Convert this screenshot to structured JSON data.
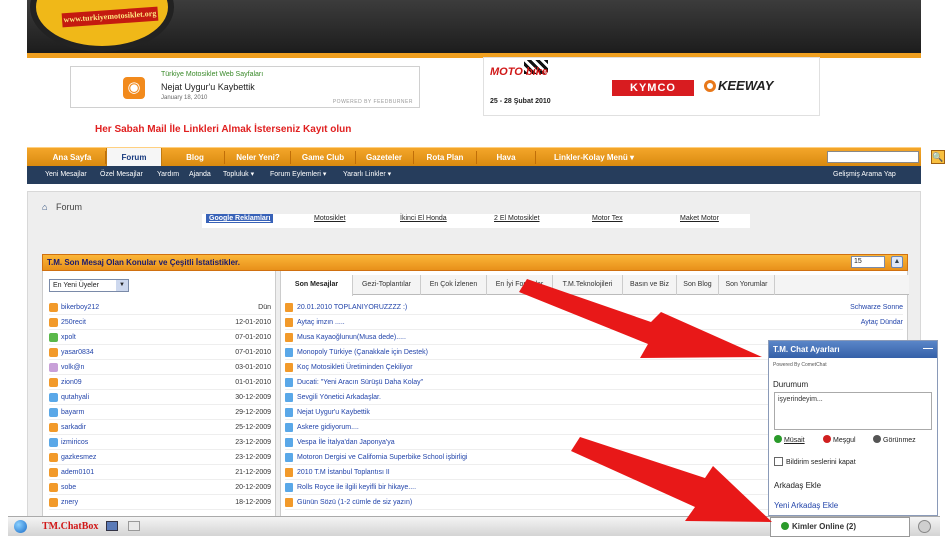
{
  "header": {
    "logo_url_text": "www.turkiyemotosiklet.org"
  },
  "feed": {
    "site_label": "Türkiye Motosiklet Web Sayfaları",
    "title": "Nejat Uygur'u Kaybettik",
    "date": "January 18, 2010",
    "powered": "POWERED BY FEEDBURNER",
    "rss_glyph": "◉"
  },
  "ad": {
    "motobike": "MOTO bike",
    "dates": "25 - 28 Şubat 2010",
    "kymco": "KYMCO",
    "keeway": "KEEWAY"
  },
  "promo": "Her Sabah Mail İle Linkleri Almak İsterseniz Kayıt olun",
  "nav": {
    "items": [
      "Ana Sayfa",
      "Forum",
      "Blog",
      "Neler Yeni?",
      "Game Club",
      "Gazeteler",
      "Rota Plan",
      "Hava",
      "Linkler-Kolay Menü ▾"
    ],
    "active": "Forum",
    "search_button": "🔍"
  },
  "subnav": {
    "items": [
      "Yeni Mesajlar",
      "Özel Mesajlar",
      "Yardım",
      "Ajanda",
      "Topluluk ▾",
      "Forum Eylemleri ▾",
      "Yararlı Linkler ▾"
    ],
    "advanced_search": "Gelişmiş Arama Yap"
  },
  "breadcrumb": {
    "home_icon": "⌂",
    "text": "Forum"
  },
  "ads_row": {
    "links": [
      "Google Reklamları",
      "Motosiklet",
      "İkinci El Honda",
      "2 El Motosiklet",
      "Motor Tex",
      "Maket Motor"
    ]
  },
  "stats": {
    "title": "T.M. Son Mesaj Olan Konular ve Çeşitli İstatistikler.",
    "count_select": "15",
    "collapse_glyph": "▲"
  },
  "users": {
    "select_label": "En Yeni Üyeler",
    "rows": [
      {
        "name": "bikerboy212",
        "date": "Dün",
        "color": "#f29a2a"
      },
      {
        "name": "250recit",
        "date": "12-01-2010",
        "color": "#f29a2a"
      },
      {
        "name": "xpolt",
        "date": "07-01-2010",
        "color": "#5ab84a"
      },
      {
        "name": "yasar0834",
        "date": "07-01-2010",
        "color": "#f29a2a"
      },
      {
        "name": "volk@n",
        "date": "03-01-2010",
        "color": "#c8a0d8"
      },
      {
        "name": "zion09",
        "date": "01-01-2010",
        "color": "#f29a2a"
      },
      {
        "name": "qutahyali",
        "date": "30-12-2009",
        "color": "#5aa8e8"
      },
      {
        "name": "bayarm",
        "date": "29-12-2009",
        "color": "#5aa8e8"
      },
      {
        "name": "sarkadir",
        "date": "25-12-2009",
        "color": "#f29a2a"
      },
      {
        "name": "izmiricos",
        "date": "23-12-2009",
        "color": "#5aa8e8"
      },
      {
        "name": "gazkesmez",
        "date": "23-12-2009",
        "color": "#f29a2a"
      },
      {
        "name": "adem0101",
        "date": "21-12-2009",
        "color": "#f29a2a"
      },
      {
        "name": "sobe",
        "date": "20-12-2009",
        "color": "#f29a2a"
      },
      {
        "name": "znery",
        "date": "18-12-2009",
        "color": "#f29a2a"
      }
    ]
  },
  "tabs": {
    "items": [
      "Son Mesajlar",
      "Gezi-Toplantılar",
      "En Çok İzlenen",
      "En İyi Forumlar",
      "T.M.Teknolojileri",
      "Basın ve Biz",
      "Son Blog",
      "Son Yorumlar"
    ],
    "active": "Son Mesajlar"
  },
  "threads": {
    "rows": [
      {
        "title": "20.01.2010 TOPLANIYORUZZZZ :)",
        "user": "Schwarze Sonne",
        "color": "#f29a2a"
      },
      {
        "title": "Aytaç imzın .....",
        "user": "Aytaç Dündar",
        "color": "#f29a2a"
      },
      {
        "title": "Musa Kayaoğlunun(Musa dede).....",
        "user": "",
        "color": "#f29a2a"
      },
      {
        "title": "Monopoly Türkiye (Çanakkale için Destek)",
        "user": "",
        "color": "#5aa8e8"
      },
      {
        "title": "Koç Motosikleti Üretiminden Çekiliyor",
        "user": "",
        "color": "#f29a2a"
      },
      {
        "title": "Ducati: \"Yeni Aracın Sürüşü Daha Kolay\"",
        "user": "",
        "color": "#5aa8e8"
      },
      {
        "title": "Sevgili Yönetici Arkadaşlar.",
        "user": "",
        "color": "#5aa8e8"
      },
      {
        "title": "Nejat Uygur'u Kaybettik",
        "user": "",
        "color": "#5aa8e8"
      },
      {
        "title": "Askere gidiyorum....",
        "user": "",
        "color": "#5aa8e8"
      },
      {
        "title": "Vespa İle İtalya'dan Japonya'ya",
        "user": "",
        "color": "#5aa8e8"
      },
      {
        "title": "Motoron Dergisi ve California Superbike School işbirligi",
        "user": "",
        "color": "#5aa8e8"
      },
      {
        "title": "2010 T.M İstanbul Toplantısı II",
        "user": "",
        "color": "#f29a2a"
      },
      {
        "title": "Rolls Royce ile ilgili keyifli bir hikaye....",
        "user": "",
        "color": "#5aa8e8"
      },
      {
        "title": "Günün Sözü (1-2 cümle de siz yazın)",
        "user": "",
        "color": "#f29a2a"
      }
    ]
  },
  "chat": {
    "title": "T.M. Chat Ayarları",
    "minimize": "—",
    "powered": "Powered By CometChat",
    "status_label": "Durumum",
    "status_text": "işyerindeyim...",
    "options": [
      "Müsait",
      "Meşgul",
      "Görünmez"
    ],
    "sound": "Bildirim seslerini kapat",
    "add_friend_header": "Arkadaş Ekle",
    "add_friend_link": "Yeni Arkadaş Ekle"
  },
  "bottombar": {
    "chatbox": "TM.ChatBox",
    "online": "Kimler Online (2)"
  },
  "colors": {
    "nav_orange": "#f4a62a",
    "subnav_navy": "#263d5c",
    "arrow_red": "#e81818",
    "chat_blue": "#3560a8"
  }
}
